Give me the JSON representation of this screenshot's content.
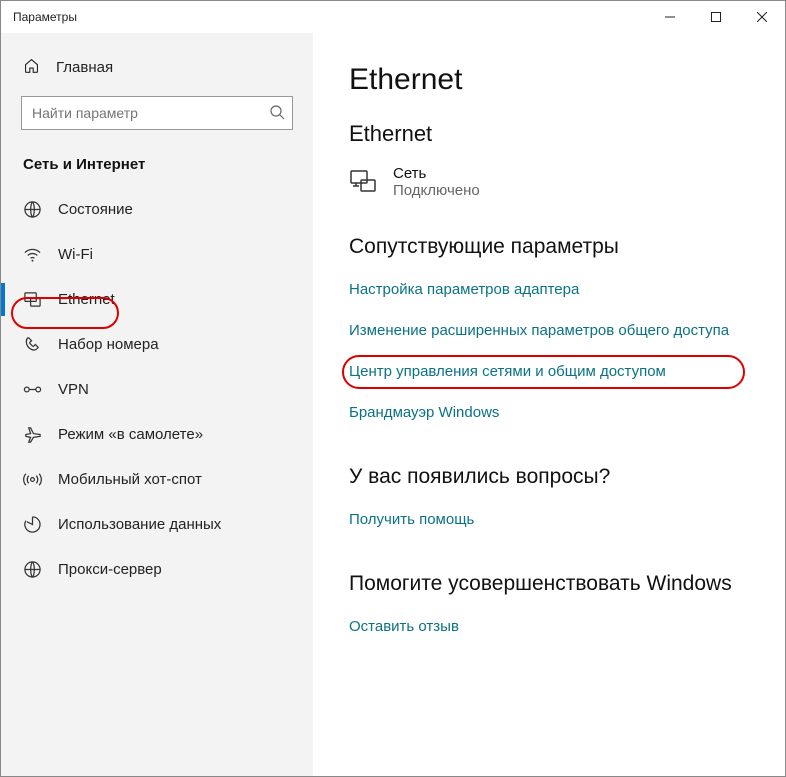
{
  "titlebar": {
    "title": "Параметры"
  },
  "sidebar": {
    "home": "Главная",
    "search_placeholder": "Найти параметр",
    "section": "Сеть и Интернет",
    "items": [
      {
        "label": "Состояние"
      },
      {
        "label": "Wi-Fi"
      },
      {
        "label": "Ethernet"
      },
      {
        "label": "Набор номера"
      },
      {
        "label": "VPN"
      },
      {
        "label": "Режим «в самолете»"
      },
      {
        "label": "Мобильный хот-спот"
      },
      {
        "label": "Использование данных"
      },
      {
        "label": "Прокси-сервер"
      }
    ]
  },
  "main": {
    "h1": "Ethernet",
    "h2": "Ethernet",
    "net_name": "Сеть",
    "net_status": "Подключено",
    "related_heading": "Сопутствующие параметры",
    "link_adapter": "Настройка параметров адаптера",
    "link_sharing": "Изменение расширенных параметров общего доступа",
    "link_center": "Центр управления сетями и общим доступом",
    "link_firewall": "Брандмауэр Windows",
    "questions_heading": "У вас появились вопросы?",
    "get_help": "Получить помощь",
    "improve_heading": "Помогите усовершенствовать Windows",
    "feedback": "Оставить отзыв"
  }
}
